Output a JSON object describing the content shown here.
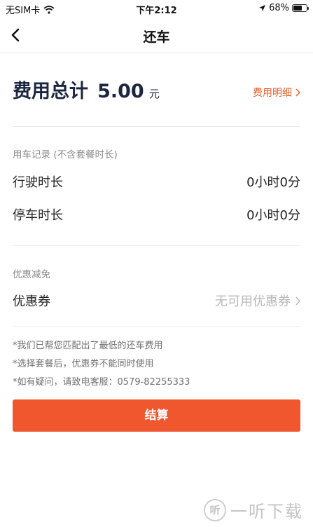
{
  "status_bar": {
    "carrier": "无SIM卡",
    "time": "下午2:12",
    "battery_percent": "68%",
    "battery_level": 0.68
  },
  "nav": {
    "title": "还车"
  },
  "total": {
    "label": "费用总计",
    "amount": "5.00",
    "unit": "元",
    "detail_link": "费用明细"
  },
  "usage": {
    "section_label": "用车记录 (不含套餐时长)",
    "rows": [
      {
        "label": "行驶时长",
        "value": "0小时0分"
      },
      {
        "label": "停车时长",
        "value": "0小时0分"
      }
    ]
  },
  "discount": {
    "section_label": "优惠减免",
    "coupon_label": "优惠券",
    "coupon_value": "无可用优惠券"
  },
  "notes": [
    "*我们已帮您匹配出了最低的还车费用",
    "*选择套餐后，优惠券不能同时使用",
    "*如有疑问，请致电客服：0579-82255333"
  ],
  "pay_button": {
    "label": "结算"
  },
  "watermark": {
    "logo_char": "听",
    "text": "一听下载"
  },
  "colors": {
    "accent": "#f0572f",
    "link": "#e8602a",
    "total_text": "#1d2640"
  }
}
